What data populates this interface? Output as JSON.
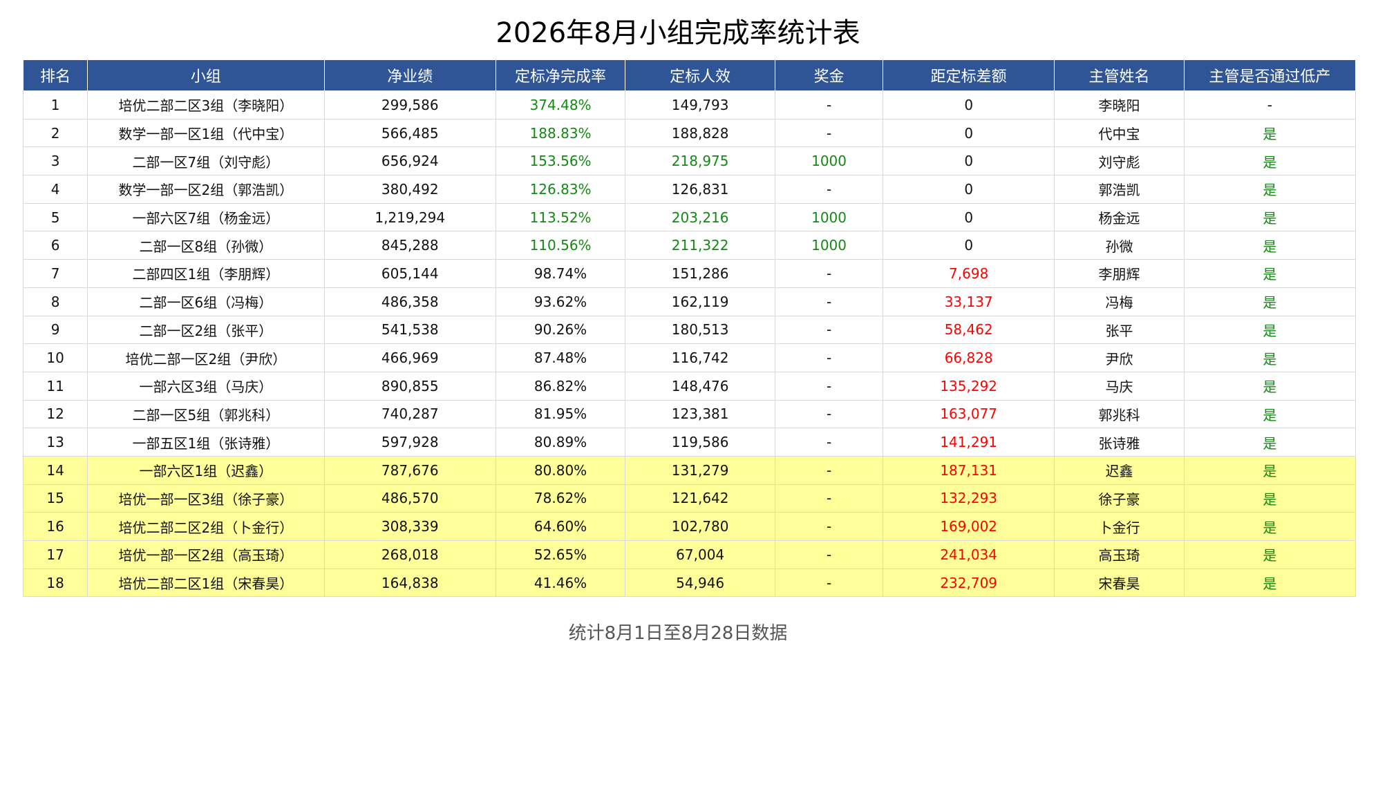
{
  "title": "2026年8月小组完成率统计表",
  "colors": {
    "header_bg": "#2f5597",
    "highlight_row": "#ffff99",
    "positive": "#118a11",
    "negative": "#ff0000"
  },
  "table": {
    "headers": [
      "排名",
      "小组",
      "净业绩",
      "定标净完成率",
      "定标人效",
      "奖金",
      "距定标差额",
      "主管姓名",
      "主管是否通过低产"
    ],
    "rows": [
      {
        "rank": "1",
        "group": "培优二部二区3组（李晓阳）",
        "net": "299,586",
        "rate": "374.48%",
        "eff": "149,793",
        "bonus": "-",
        "gap": "0",
        "manager": "李晓阳",
        "pass": "-",
        "rate_good": true,
        "eff_good": false,
        "bonus_good": false,
        "gap_bad": false,
        "pass_good": false,
        "highlight": false
      },
      {
        "rank": "2",
        "group": "数学一部一区1组（代中宝）",
        "net": "566,485",
        "rate": "188.83%",
        "eff": "188,828",
        "bonus": "-",
        "gap": "0",
        "manager": "代中宝",
        "pass": "是",
        "rate_good": true,
        "eff_good": false,
        "bonus_good": false,
        "gap_bad": false,
        "pass_good": true,
        "highlight": false
      },
      {
        "rank": "3",
        "group": "二部一区7组（刘守彪）",
        "net": "656,924",
        "rate": "153.56%",
        "eff": "218,975",
        "bonus": "1000",
        "gap": "0",
        "manager": "刘守彪",
        "pass": "是",
        "rate_good": true,
        "eff_good": true,
        "bonus_good": true,
        "gap_bad": false,
        "pass_good": true,
        "highlight": false
      },
      {
        "rank": "4",
        "group": "数学一部一区2组（郭浩凯）",
        "net": "380,492",
        "rate": "126.83%",
        "eff": "126,831",
        "bonus": "-",
        "gap": "0",
        "manager": "郭浩凯",
        "pass": "是",
        "rate_good": true,
        "eff_good": false,
        "bonus_good": false,
        "gap_bad": false,
        "pass_good": true,
        "highlight": false
      },
      {
        "rank": "5",
        "group": "一部六区7组（杨金远）",
        "net": "1,219,294",
        "rate": "113.52%",
        "eff": "203,216",
        "bonus": "1000",
        "gap": "0",
        "manager": "杨金远",
        "pass": "是",
        "rate_good": true,
        "eff_good": true,
        "bonus_good": true,
        "gap_bad": false,
        "pass_good": true,
        "highlight": false
      },
      {
        "rank": "6",
        "group": "二部一区8组（孙微）",
        "net": "845,288",
        "rate": "110.56%",
        "eff": "211,322",
        "bonus": "1000",
        "gap": "0",
        "manager": "孙微",
        "pass": "是",
        "rate_good": true,
        "eff_good": true,
        "bonus_good": true,
        "gap_bad": false,
        "pass_good": true,
        "highlight": false
      },
      {
        "rank": "7",
        "group": "二部四区1组（李朋辉）",
        "net": "605,144",
        "rate": "98.74%",
        "eff": "151,286",
        "bonus": "-",
        "gap": "7,698",
        "manager": "李朋辉",
        "pass": "是",
        "rate_good": false,
        "eff_good": false,
        "bonus_good": false,
        "gap_bad": true,
        "pass_good": true,
        "highlight": false
      },
      {
        "rank": "8",
        "group": "二部一区6组（冯梅）",
        "net": "486,358",
        "rate": "93.62%",
        "eff": "162,119",
        "bonus": "-",
        "gap": "33,137",
        "manager": "冯梅",
        "pass": "是",
        "rate_good": false,
        "eff_good": false,
        "bonus_good": false,
        "gap_bad": true,
        "pass_good": true,
        "highlight": false
      },
      {
        "rank": "9",
        "group": "二部一区2组（张平）",
        "net": "541,538",
        "rate": "90.26%",
        "eff": "180,513",
        "bonus": "-",
        "gap": "58,462",
        "manager": "张平",
        "pass": "是",
        "rate_good": false,
        "eff_good": false,
        "bonus_good": false,
        "gap_bad": true,
        "pass_good": true,
        "highlight": false
      },
      {
        "rank": "10",
        "group": "培优二部一区2组（尹欣）",
        "net": "466,969",
        "rate": "87.48%",
        "eff": "116,742",
        "bonus": "-",
        "gap": "66,828",
        "manager": "尹欣",
        "pass": "是",
        "rate_good": false,
        "eff_good": false,
        "bonus_good": false,
        "gap_bad": true,
        "pass_good": true,
        "highlight": false
      },
      {
        "rank": "11",
        "group": "一部六区3组（马庆）",
        "net": "890,855",
        "rate": "86.82%",
        "eff": "148,476",
        "bonus": "-",
        "gap": "135,292",
        "manager": "马庆",
        "pass": "是",
        "rate_good": false,
        "eff_good": false,
        "bonus_good": false,
        "gap_bad": true,
        "pass_good": true,
        "highlight": false
      },
      {
        "rank": "12",
        "group": "二部一区5组（郭兆科）",
        "net": "740,287",
        "rate": "81.95%",
        "eff": "123,381",
        "bonus": "-",
        "gap": "163,077",
        "manager": "郭兆科",
        "pass": "是",
        "rate_good": false,
        "eff_good": false,
        "bonus_good": false,
        "gap_bad": true,
        "pass_good": true,
        "highlight": false
      },
      {
        "rank": "13",
        "group": "一部五区1组（张诗雅）",
        "net": "597,928",
        "rate": "80.89%",
        "eff": "119,586",
        "bonus": "-",
        "gap": "141,291",
        "manager": "张诗雅",
        "pass": "是",
        "rate_good": false,
        "eff_good": false,
        "bonus_good": false,
        "gap_bad": true,
        "pass_good": true,
        "highlight": false
      },
      {
        "rank": "14",
        "group": "一部六区1组（迟鑫）",
        "net": "787,676",
        "rate": "80.80%",
        "eff": "131,279",
        "bonus": "-",
        "gap": "187,131",
        "manager": "迟鑫",
        "pass": "是",
        "rate_good": false,
        "eff_good": false,
        "bonus_good": false,
        "gap_bad": true,
        "pass_good": true,
        "highlight": true
      },
      {
        "rank": "15",
        "group": "培优一部一区3组（徐子豪）",
        "net": "486,570",
        "rate": "78.62%",
        "eff": "121,642",
        "bonus": "-",
        "gap": "132,293",
        "manager": "徐子豪",
        "pass": "是",
        "rate_good": false,
        "eff_good": false,
        "bonus_good": false,
        "gap_bad": true,
        "pass_good": true,
        "highlight": true
      },
      {
        "rank": "16",
        "group": "培优二部二区2组（卜金行）",
        "net": "308,339",
        "rate": "64.60%",
        "eff": "102,780",
        "bonus": "-",
        "gap": "169,002",
        "manager": "卜金行",
        "pass": "是",
        "rate_good": false,
        "eff_good": false,
        "bonus_good": false,
        "gap_bad": true,
        "pass_good": true,
        "highlight": true
      },
      {
        "rank": "17",
        "group": "培优一部一区2组（高玉琦）",
        "net": "268,018",
        "rate": "52.65%",
        "eff": "67,004",
        "bonus": "-",
        "gap": "241,034",
        "manager": "高玉琦",
        "pass": "是",
        "rate_good": false,
        "eff_good": false,
        "bonus_good": false,
        "gap_bad": true,
        "pass_good": true,
        "highlight": true
      },
      {
        "rank": "18",
        "group": "培优二部二区1组（宋春昊）",
        "net": "164,838",
        "rate": "41.46%",
        "eff": "54,946",
        "bonus": "-",
        "gap": "232,709",
        "manager": "宋春昊",
        "pass": "是",
        "rate_good": false,
        "eff_good": false,
        "bonus_good": false,
        "gap_bad": true,
        "pass_good": true,
        "highlight": true
      }
    ]
  },
  "footnote": "统计8月1日至8月28日数据"
}
